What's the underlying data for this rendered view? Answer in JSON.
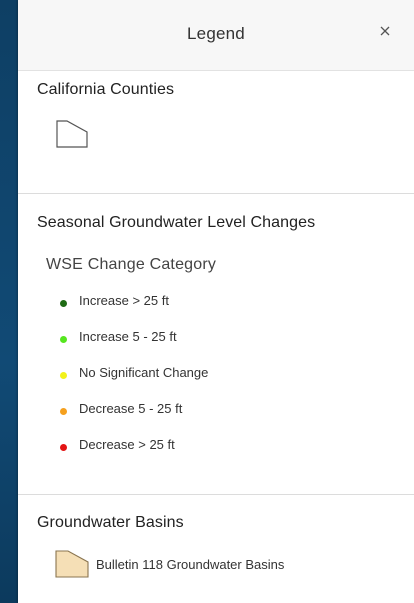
{
  "legend": {
    "title": "Legend",
    "close_glyph": "×"
  },
  "layers": {
    "counties": {
      "title": "California Counties",
      "symbol_icon": "polygon-outline-icon",
      "fill_color": "#ffffff",
      "outline_color": "#555555"
    },
    "groundwater_changes": {
      "title": "Seasonal Groundwater Level Changes",
      "field_label": "WSE Change Category",
      "categories": [
        {
          "label": "Increase > 25 ft",
          "color": "#1e6b14"
        },
        {
          "label": "Increase 5 - 25 ft",
          "color": "#56e61f"
        },
        {
          "label": "No Significant Change",
          "color": "#f2f21a"
        },
        {
          "label": "Decrease 5 - 25 ft",
          "color": "#f5a01e"
        },
        {
          "label": "Decrease > 25 ft",
          "color": "#e31414"
        }
      ]
    },
    "basins": {
      "title": "Groundwater Basins",
      "item_label": "Bulletin 118 Groundwater Basins",
      "symbol_icon": "polygon-fill-icon",
      "fill_color": "#f5dfb6",
      "outline_color": "#8a7550"
    }
  }
}
